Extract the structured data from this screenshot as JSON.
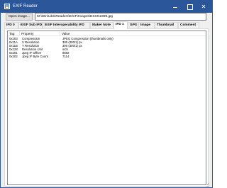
{
  "window": {
    "title": "EXIF Reader",
    "controls": {
      "minimize": "",
      "maximize": "",
      "close": "✕"
    }
  },
  "toolbar": {
    "open_button_label": "Open image...",
    "file_path": "M:\\Win\\Libs\\Readers\\EXIF\\Images\\DSCN2399.jpg"
  },
  "tabs": [
    {
      "label": "IFD 0",
      "active": false
    },
    {
      "label": "EXIF Sub IFD",
      "active": false
    },
    {
      "label": "EXIF Interoperability IFD",
      "active": false
    },
    {
      "label": "Maker Note",
      "active": false
    },
    {
      "label": "IFD 1",
      "active": true
    },
    {
      "label": "GPS",
      "active": false
    },
    {
      "label": "Image",
      "active": false
    },
    {
      "label": "Thumbnail",
      "active": false
    },
    {
      "label": "Comment",
      "active": false
    }
  ],
  "table": {
    "headers": [
      "Tag",
      "Property",
      "Value"
    ],
    "rows": [
      {
        "tag": "0x103",
        "property": "Compression",
        "value": "JPEG Compression (thumbnails only)"
      },
      {
        "tag": "0x11A",
        "property": "X Resolution",
        "value": "300 (300/1) px"
      },
      {
        "tag": "0x11B",
        "property": "Y Resolution",
        "value": "300 (300/1) px"
      },
      {
        "tag": "0x128",
        "property": "Resolution Unit",
        "value": "inch"
      },
      {
        "tag": "0x201",
        "property": "Jpeg IF Offset",
        "value": "8692"
      },
      {
        "tag": "0x202",
        "property": "Jpeg IF Byte Count",
        "value": "7114"
      }
    ]
  }
}
